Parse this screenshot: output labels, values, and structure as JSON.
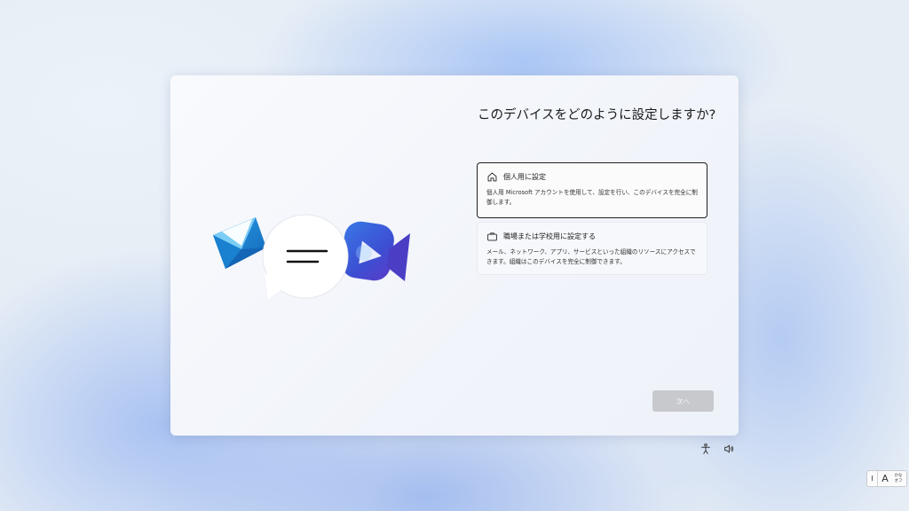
{
  "setup": {
    "heading": "このデバイスをどのように設定しますか?",
    "options": [
      {
        "icon": "home-icon",
        "title": "個人用に設定",
        "description": "個人用 Microsoft アカウントを使用して、設定を行い、このデバイスを完全に制御します。",
        "selected": true
      },
      {
        "icon": "briefcase-icon",
        "title": "職場または学校用に設定する",
        "description": "メール、ネットワーク、アプリ、サービスといった組織のリソースにアクセスできます。組織はこのデバイスを完全に制御できます。",
        "selected": false
      }
    ],
    "next_label": "次へ"
  },
  "tray": {
    "accessibility_icon": "accessibility-icon",
    "volume_icon": "volume-icon"
  },
  "ime": {
    "mode_char": "A",
    "kana_top": "かな",
    "kana_bottom": "オフ"
  },
  "colors": {
    "selected_border": "#1f1f1f",
    "disabled_button": "#c7c9cd",
    "mail_blue": "#1f8ad6",
    "video_blue": "#3a5bd8"
  }
}
